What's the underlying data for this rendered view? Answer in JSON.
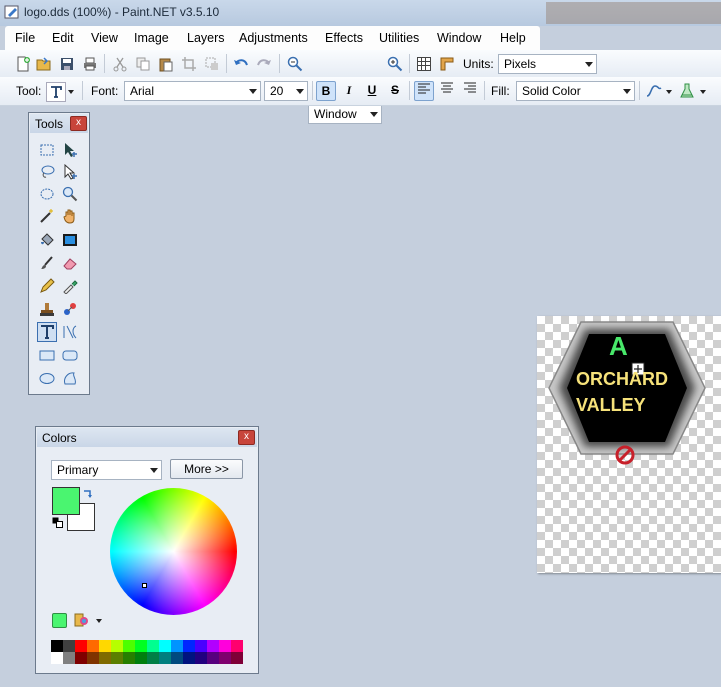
{
  "window": {
    "title": "logo.dds (100%) - Paint.NET v3.5.10"
  },
  "menu": [
    "File",
    "Edit",
    "View",
    "Image",
    "Layers",
    "Adjustments",
    "Effects",
    "Utilities",
    "Window",
    "Help"
  ],
  "toolbar1": {
    "zoom_value": "Window",
    "units_label": "Units:",
    "units_value": "Pixels"
  },
  "toolbar2": {
    "tool_label": "Tool:",
    "font_label": "Font:",
    "font_value": "Arial",
    "size_value": "20",
    "bold": "B",
    "italic": "I",
    "underline": "U",
    "strike": "S",
    "fill_label": "Fill:",
    "fill_value": "Solid Color"
  },
  "tools_window": {
    "title": "Tools",
    "close": "x"
  },
  "colors_window": {
    "title": "Colors",
    "close": "x",
    "mode_value": "Primary",
    "more_button": "More >>",
    "primary_color": "#4af570",
    "secondary_color": "#ffffff",
    "palette_top": [
      "#000000",
      "#404040",
      "#ff0000",
      "#ff6a00",
      "#ffd800",
      "#b6ff00",
      "#4cff00",
      "#00ff21",
      "#00ff90",
      "#00ffff",
      "#0094ff",
      "#0026ff",
      "#4800ff",
      "#b200ff",
      "#ff00dc",
      "#ff006e"
    ],
    "palette_bottom": [
      "#ffffff",
      "#808080",
      "#7f0000",
      "#7f3300",
      "#7f6a00",
      "#5b7f00",
      "#267f00",
      "#007f0e",
      "#007f46",
      "#007f7f",
      "#004a7f",
      "#00137f",
      "#21007f",
      "#57007f",
      "#7f006e",
      "#7f0037"
    ]
  },
  "image": {
    "letter": "A",
    "line1": "ORCHARD",
    "line2": "VALLEY",
    "letter_color": "#48e86a",
    "text_color": "#f6e27a"
  }
}
